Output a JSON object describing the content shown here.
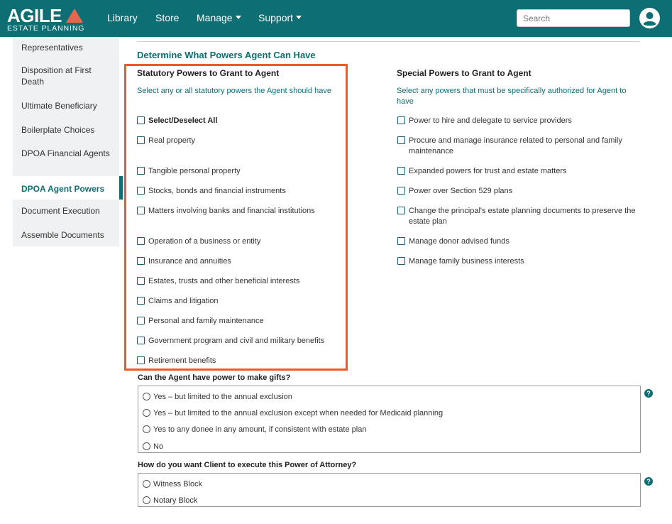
{
  "brand": {
    "name": "AGILE",
    "subtitle": "ESTATE PLANNING"
  },
  "nav": {
    "library": "Library",
    "store": "Store",
    "manage": "Manage",
    "support": "Support",
    "search_placeholder": "Search"
  },
  "sidebar": {
    "items": [
      {
        "label": "Representatives"
      },
      {
        "label": "Disposition at First Death"
      },
      {
        "label": "Ultimate Beneficiary"
      },
      {
        "label": "Boilerplate Choices"
      },
      {
        "label": "DPOA Financial Agents"
      },
      {
        "label": "DPOA Agent Powers",
        "active": true
      },
      {
        "label": "Document Execution"
      },
      {
        "label": "Assemble Documents"
      }
    ]
  },
  "main": {
    "title": "Determine What Powers Agent Can Have",
    "statutory": {
      "title": "Statutory Powers to Grant to Agent",
      "hint": "Select any or all statutory powers the Agent should have",
      "select_all": "Select/Deselect All",
      "items": [
        "Real property",
        "Tangible personal property",
        "Stocks, bonds and financial instruments",
        "Matters involving banks and financial institutions",
        "Operation of a business or entity",
        "Insurance and annuities",
        "Estates, trusts and other beneficial interests",
        "Claims and litigation",
        "Personal and family maintenance",
        "Government program and civil and military benefits",
        "Retirement benefits"
      ]
    },
    "special": {
      "title": "Special Powers to Grant to Agent",
      "hint": "Select any powers that must be specifically authorized for Agent to have",
      "items": [
        "Power to hire and delegate to service providers",
        "Procure and manage insurance related to personal and family maintenance",
        "Expanded powers for trust and estate matters",
        "Power over Section 529 plans",
        "Change the principal's estate planning documents to preserve the estate plan",
        "Manage donor advised funds",
        "Manage family business interests"
      ]
    },
    "gifts": {
      "question": "Can the Agent have power to make gifts?",
      "options": [
        "Yes – but limited to the annual exclusion",
        "Yes – but limited to the annual exclusion except when needed for Medicaid planning",
        "Yes to any donee in any amount, if consistent with estate plan",
        "No"
      ]
    },
    "execution": {
      "question": "How do you want Client to execute this Power of Attorney?",
      "options": [
        "Witness Block",
        "Notary Block"
      ]
    },
    "help_glyph": "?"
  },
  "colors": {
    "brand": "#0d6e73",
    "accent": "#e8674a",
    "highlight": "#f05a22"
  },
  "icons": {
    "user": "user-circle-icon",
    "help": "help-circle-icon",
    "logo": "triangle-icon"
  }
}
